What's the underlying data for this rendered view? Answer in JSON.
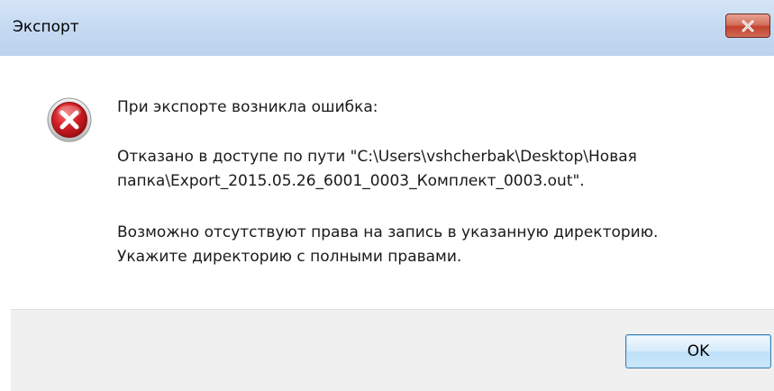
{
  "window": {
    "title": "Экспорт"
  },
  "icons": {
    "error": "error-icon",
    "close": "close-icon"
  },
  "message": {
    "header": "При экспорте возникла ошибка:",
    "line1": "Отказано в доступе по пути \"C:\\Users\\vshcherbak\\Desktop\\Новая",
    "line2": "папка\\Export_2015.05.26_6001_0003_Комплект_0003.out\".",
    "line3": "Возможно отсутствуют права на запись в указанную директорию.",
    "line4": "Укажите директорию с полными правами."
  },
  "buttons": {
    "ok_label": "OK"
  },
  "colors": {
    "title_bar": "#c7dbf2",
    "close_button": "#c2422e",
    "error_icon": "#c8161d",
    "footer": "#f0f0f0"
  }
}
